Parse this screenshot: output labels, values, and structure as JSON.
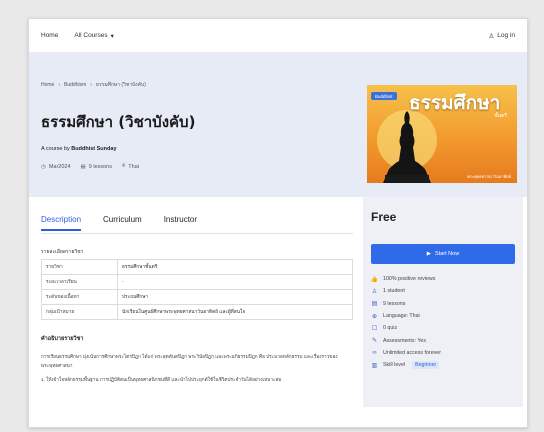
{
  "nav": {
    "home": "Home",
    "courses": "All Courses",
    "login": "Log in"
  },
  "breadcrumb": {
    "home": "Home",
    "cat": "Buddhism",
    "current": "ธรรมศึกษา (วิชาบังคับ)"
  },
  "course": {
    "title": "ธรรมศึกษา (วิชาบังคับ)",
    "byline_prefix": "A course by",
    "author": "Buddhist Sunday",
    "date": "Mar2024",
    "lessons": "9 lessons",
    "language": "Thai"
  },
  "thumbnail": {
    "badge": "Buddhist",
    "title": "ธรรมศึกษา",
    "sub": "ชั้นตรี",
    "footer": "พระพุทธศาสนาวันอาทิตย์"
  },
  "tabs": [
    "Description",
    "Curriculum",
    "Instructor"
  ],
  "info": {
    "label": "รายละเอียดรายวิชา",
    "rows": [
      {
        "k": "รายวิชา",
        "v": "ธรรมศึกษาชั้นตรี"
      },
      {
        "k": "ระยะเวลาเรียน",
        "v": "-"
      },
      {
        "k": "ระดับของเนื้อหา",
        "v": "ประถมศึกษา"
      },
      {
        "k": "กลุ่มเป้าหมาย",
        "v": "นักเรียนในศูนย์ศึกษาพระพุทธศาสนาวันอาทิตย์ และผู้ที่สนใจ"
      }
    ]
  },
  "description": {
    "heading": "คำอธิบายรายวิชา",
    "p1": "การเรียนธรรมศึกษา มุ่งเน้นการศึกษาพระไตรปิฎก ได้แก่ พระสุตตันตปิฎก พระวินัยปิฎก และพระอภิธรรมปิฎก คือ ประมวลหลักธรรม และเรื่องราวของพระพุทธศาสนา",
    "p2": "1. ให้เข้าใจหลักธรรมพื้นฐาน การปฏิบัติตนเป็นพุทธศาสนิกชนที่ดี และนำไปประยุกต์ใช้ในชีวิตประจำวันได้อย่างเหมาะสม"
  },
  "sidebar": {
    "price": "Free",
    "start": "Start Now",
    "features": [
      {
        "icon": "thumbs-up-icon",
        "text": "100% positive reviews"
      },
      {
        "icon": "user-icon",
        "text": "1 student"
      },
      {
        "icon": "lesson-icon",
        "text": "9 lessons"
      },
      {
        "icon": "globe-icon",
        "text": "Language: Thai"
      },
      {
        "icon": "quiz-icon",
        "text": "0 quiz"
      },
      {
        "icon": "assessment-icon",
        "text": "Assessments: Yes"
      },
      {
        "icon": "infinity-icon",
        "text": "Unlimited access forever"
      },
      {
        "icon": "skill-icon",
        "text": "Skill level",
        "badge": "Beginner"
      }
    ]
  }
}
